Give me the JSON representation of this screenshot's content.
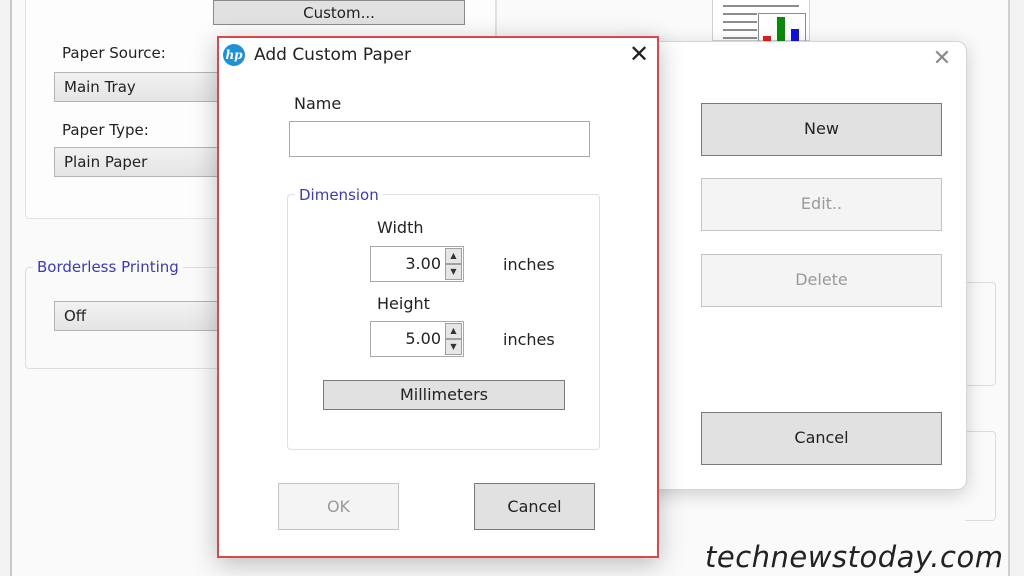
{
  "background": {
    "custom_button": "Custom...",
    "paper_source_label": "Paper Source:",
    "paper_source_value": "Main Tray",
    "paper_type_label": "Paper Type:",
    "paper_type_value": "Plain Paper",
    "borderless_group": "Borderless Printing",
    "borderless_value": "Off",
    "preview_colors": {
      "red": "#e02020",
      "green": "#0a8a0a",
      "blue": "#1010e0"
    }
  },
  "manager_dialog": {
    "close_icon": "close-icon",
    "buttons": {
      "new": "New",
      "edit": "Edit..",
      "delete": "Delete",
      "cancel": "Cancel"
    }
  },
  "add_custom_paper": {
    "title": "Add Custom Paper",
    "app_icon_text": "hp",
    "close_glyph": "✕",
    "name_label": "Name",
    "name_value": "",
    "dimension_group": "Dimension",
    "width_label": "Width",
    "width_value": "3.00",
    "width_unit": "inches",
    "height_label": "Height",
    "height_value": "5.00",
    "height_unit": "inches",
    "units_button": "Millimeters",
    "ok_button": "OK",
    "cancel_button": "Cancel",
    "border_color": "#d9484b",
    "legend_color": "#3b3bb3"
  },
  "watermark": "technewstoday.com"
}
